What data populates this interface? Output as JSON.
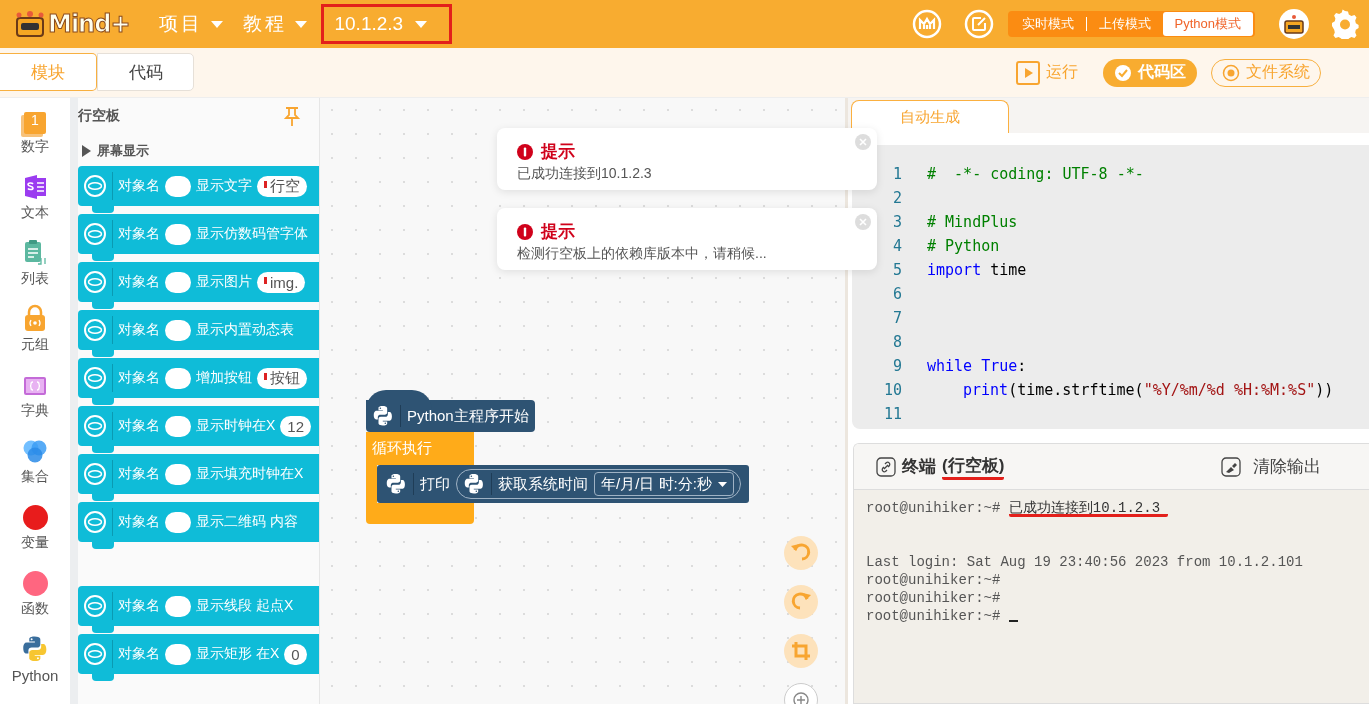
{
  "header": {
    "logo": "Mind+",
    "menus": [
      {
        "label": "项目"
      },
      {
        "label": "教程"
      }
    ],
    "device": {
      "label": "10.1.2.3",
      "highlighted": true
    },
    "modes": [
      {
        "label": "实时模式",
        "selected": false
      },
      {
        "label": "上传模式",
        "selected": false
      },
      {
        "label": "Python模式",
        "selected": true
      }
    ]
  },
  "view_tabs": [
    {
      "label": "模块",
      "selected": true
    },
    {
      "label": "代码",
      "selected": false
    }
  ],
  "actions": [
    {
      "kind": "run",
      "label": "运行",
      "selected": false
    },
    {
      "kind": "code",
      "label": "代码区",
      "selected": true
    },
    {
      "kind": "files",
      "label": "文件系统",
      "selected": false
    }
  ],
  "categories": [
    {
      "kind": "number",
      "label": "数字",
      "glyph": "1"
    },
    {
      "kind": "text",
      "label": "文本"
    },
    {
      "kind": "list",
      "label": "列表"
    },
    {
      "kind": "tuple",
      "label": "元组"
    },
    {
      "kind": "dict",
      "label": "字典"
    },
    {
      "kind": "set",
      "label": "集合"
    },
    {
      "kind": "variable",
      "label": "变量",
      "color": "#e81c1c"
    },
    {
      "kind": "function",
      "label": "函数",
      "color": "#ff6680"
    },
    {
      "kind": "python",
      "label": "Python"
    }
  ],
  "palette": {
    "title": "行空板",
    "section": "屏幕显示",
    "blocks": [
      {
        "object": "对象名",
        "label": "显示文字",
        "field": {
          "quoted": true,
          "value": "行空"
        }
      },
      {
        "object": "对象名",
        "label": "显示仿数码管字体"
      },
      {
        "object": "对象名",
        "label": "显示图片",
        "field": {
          "quoted": true,
          "value": "img."
        }
      },
      {
        "object": "对象名",
        "label": "显示内置动态表"
      },
      {
        "object": "对象名",
        "label": "增加按钮",
        "field": {
          "quoted": true,
          "value": "按钮"
        }
      },
      {
        "object": "对象名",
        "label": "显示时钟在X",
        "field": {
          "quoted": false,
          "value": "12"
        }
      },
      {
        "object": "对象名",
        "label": "显示填充时钟在X"
      },
      {
        "object": "对象名",
        "label": "显示二维码 内容"
      },
      {
        "object": "对象名",
        "label": "显示线段 起点X"
      },
      {
        "object": "对象名",
        "label": "显示矩形 在X",
        "field": {
          "quoted": false,
          "value": "0"
        }
      }
    ]
  },
  "notifications": [
    {
      "title": "提示",
      "message": "已成功连接到10.1.2.3"
    },
    {
      "title": "提示",
      "message": "检测行空板上的依赖库版本中，请稍候..."
    }
  ],
  "program": {
    "hat": "Python主程序开始",
    "loop": "循环执行",
    "print": "打印",
    "reporter": "获取系统时间",
    "format": "年/月/日 时:分:秒"
  },
  "code": {
    "tab": {
      "label": "自动生成",
      "selected": true
    },
    "lines": [
      {
        "number": "1",
        "tokens": [
          {
            "kind": "comment",
            "text": "#  -*- coding: UTF-8 -*-"
          }
        ]
      },
      {
        "number": "2"
      },
      {
        "number": "3",
        "tokens": [
          {
            "kind": "comment",
            "text": "# MindPlus"
          }
        ]
      },
      {
        "number": "4",
        "tokens": [
          {
            "kind": "comment",
            "text": "# Python"
          }
        ]
      },
      {
        "number": "5",
        "tokens": [
          {
            "kind": "keyword",
            "text": "import"
          },
          {
            "kind": "plain",
            "text": " time"
          }
        ]
      },
      {
        "number": "6"
      },
      {
        "number": "7"
      },
      {
        "number": "8"
      },
      {
        "number": "9",
        "tokens": [
          {
            "kind": "keyword",
            "text": "while True"
          },
          {
            "kind": "plain",
            "text": ":"
          }
        ]
      },
      {
        "number": "10",
        "indented": true,
        "tokens": [
          {
            "kind": "keyword",
            "text": "print"
          },
          {
            "kind": "plain",
            "text": "(time.strftime("
          },
          {
            "kind": "string",
            "text": "\"%Y/%m/%d %H:%M:%S\""
          },
          {
            "kind": "plain",
            "text": "))"
          }
        ]
      },
      {
        "number": "11"
      }
    ]
  },
  "terminal": {
    "title": "终端",
    "device": "(行空板)",
    "device_underlined": true,
    "clear": "清除输出",
    "lines": [
      {
        "prompt": "root@unihiker:~#",
        "text": "已成功连接到10.1.2.3",
        "underlined": true
      },
      {
        "text": "Last login: Sat Aug 19 23:40:56 2023 from 10.1.2.101"
      },
      {
        "prompt": "root@unihiker:~#"
      },
      {
        "prompt": "root@unihiker:~#"
      },
      {
        "prompt": "root@unihiker:~#",
        "cursor": true
      }
    ]
  }
}
